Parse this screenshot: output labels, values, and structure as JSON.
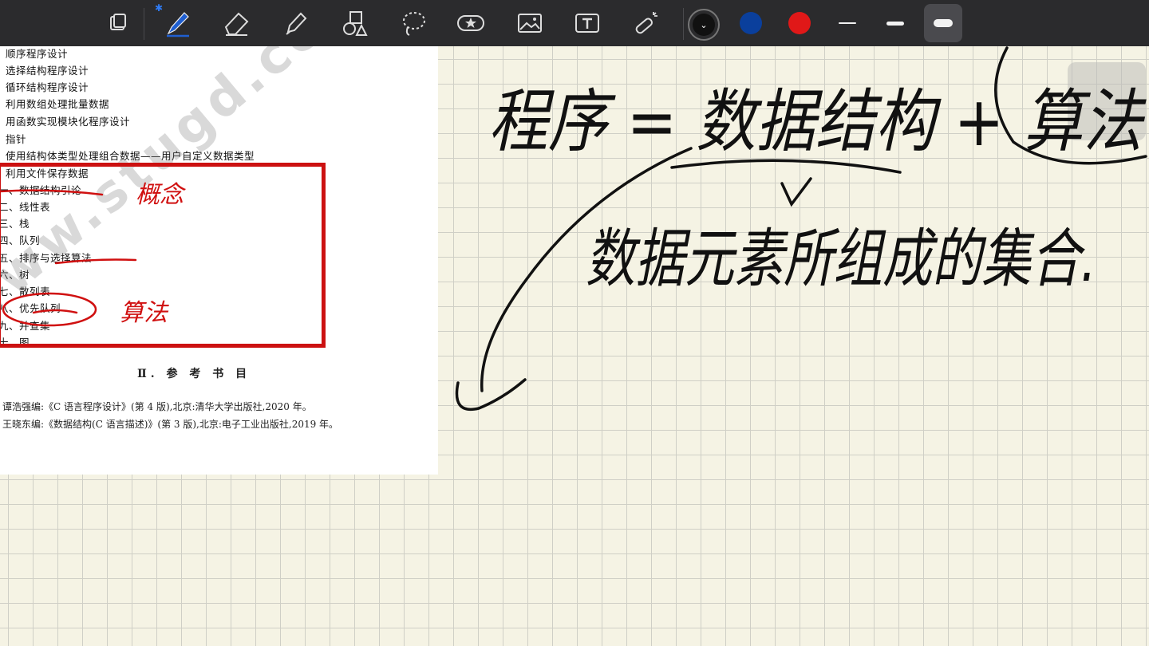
{
  "toolbar": {
    "tools": [
      {
        "name": "page-layout-icon"
      },
      {
        "name": "pen-icon",
        "active": true
      },
      {
        "name": "eraser-icon"
      },
      {
        "name": "highlighter-icon"
      },
      {
        "name": "shapes-icon"
      },
      {
        "name": "lasso-icon"
      },
      {
        "name": "sticker-icon"
      },
      {
        "name": "image-icon"
      },
      {
        "name": "text-box-icon"
      },
      {
        "name": "laser-pointer-icon"
      }
    ],
    "colors": [
      "#111111",
      "#0a3f9c",
      "#e01818"
    ],
    "stroke_sizes": [
      "thin",
      "medium",
      "thick"
    ],
    "bluetooth_icon": "bluetooth-icon"
  },
  "document": {
    "items": [
      "顺序程序设计",
      "选择结构程序设计",
      "循环结构程序设计",
      "利用数组处理批量数据",
      "用函数实现模块化程序设计",
      "指针",
      "使用结构体类型处理组合数据——用户自定义数据类型",
      "利用文件保存数据",
      "一、数据结构引论",
      "二、线性表",
      "三、栈",
      "四、队列",
      "五、排序与选择算法",
      "六、树",
      "七、散列表",
      "八、优先队列",
      "九、并查集",
      "十、图"
    ],
    "ref_title": "Ⅱ. 参 考 书 目",
    "refs": [
      "谭浩强编:《C 语言程序设计》(第 4 版),北京:清华大学出版社,2020 年。",
      "王晓东编:《数据结构(C 语言描述)》(第 3 版),北京:电子工业出版社,2019 年。"
    ],
    "watermark": "www.stugd.com 考友考研"
  },
  "handwriting": {
    "annotation_1": "概念",
    "annotation_2": "算法",
    "line_1": "程序 = 数据结构 + 算法",
    "line_2": "数据元素所组成的集合."
  }
}
